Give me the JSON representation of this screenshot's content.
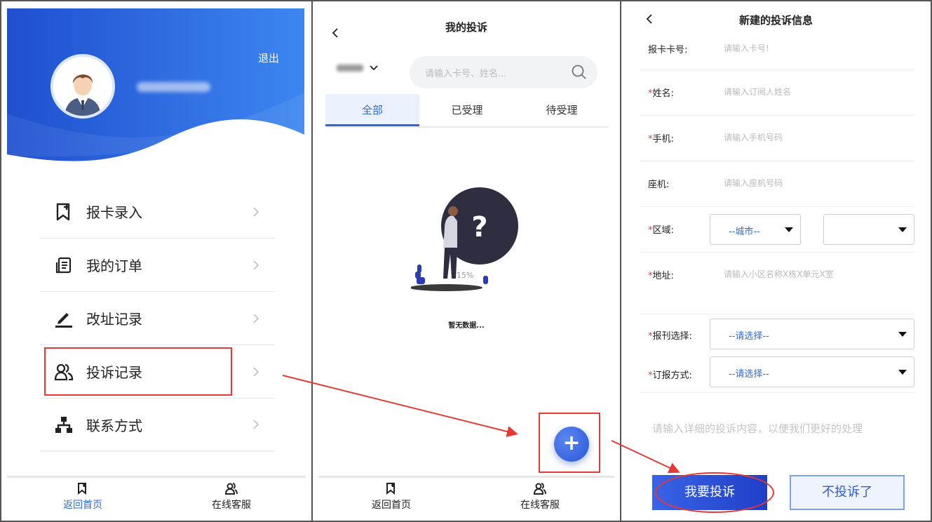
{
  "panel1": {
    "logout_label": "退出",
    "menu": [
      {
        "label": "报卡录入",
        "icon": "card-add-icon"
      },
      {
        "label": "我的订单",
        "icon": "order-list-icon"
      },
      {
        "label": "改址记录",
        "icon": "edit-pen-icon"
      },
      {
        "label": "投诉记录",
        "icon": "complaint-users-icon"
      },
      {
        "label": "联系方式",
        "icon": "org-chart-icon"
      }
    ],
    "tabbar": {
      "home_label": "返回首页",
      "service_label": "在线客服"
    }
  },
  "panel2": {
    "title": "我的投诉",
    "search_placeholder": "请输入卡号、姓名...",
    "tabs": [
      "全部",
      "已受理",
      "待受理"
    ],
    "empty_text": "暂无数据...",
    "loading_text": "15%",
    "fab_label": "+",
    "tabbar": {
      "home_label": "返回首页",
      "service_label": "在线客服"
    }
  },
  "panel3": {
    "title": "新建的投诉信息",
    "fields": [
      {
        "label": "报卡卡号:",
        "required": false,
        "placeholder": "请输入卡号!"
      },
      {
        "label": "姓名:",
        "required": true,
        "placeholder": "请输入订阅人姓名"
      },
      {
        "label": "手机:",
        "required": true,
        "placeholder": "请输入手机号码"
      },
      {
        "label": "座机:",
        "required": false,
        "placeholder": "请输入座机号码"
      }
    ],
    "region_label": "区域:",
    "region_select1": "--城市--",
    "region_select2": "",
    "address_label": "地址:",
    "address_placeholder": "请输入小区名称X栋X单元X室",
    "newspaper_label": "报刊选择:",
    "newspaper_value": "--请选择--",
    "method_label": "订报方式:",
    "method_value": "--请选择--",
    "complaint_placeholder": "请输入详细的投诉内容，以便我们更好的处理",
    "submit_label": "我要投诉",
    "cancel_label": "不投诉了",
    "required_mark": "*"
  },
  "colors": {
    "accent": "#2f6bd6",
    "highlight": "#e53935",
    "hero_start": "#1f4fcf",
    "hero_end": "#3d86f0"
  }
}
